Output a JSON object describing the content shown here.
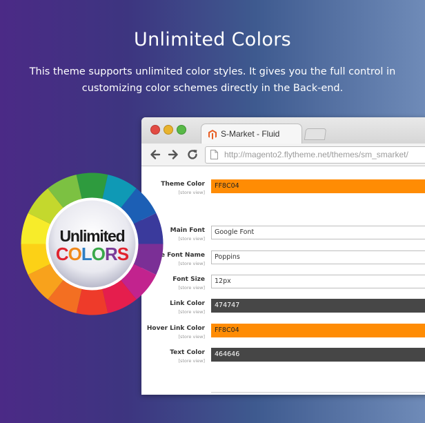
{
  "hero": {
    "title": "Unlimited Colors",
    "subtitle_line1": "This theme supports unlimited color styles. It gives you the full control in",
    "subtitle_line2": "customizing color schemes directly in the Back-end."
  },
  "browser": {
    "tab_title": "S-Market - Fluid",
    "url": "http://magento2.flytheme.net/themes/sm_smarket/",
    "tab_icon": "magento-logo-icon"
  },
  "badge": {
    "line1": "Unlimited",
    "line2_letters": [
      "C",
      "O",
      "L",
      "O",
      "R",
      "S"
    ],
    "line2_colors": [
      "#e0232e",
      "#f08a1c",
      "#2d7ec3",
      "#3aa84a",
      "#7a3b97",
      "#e0232e"
    ]
  },
  "form": {
    "scope_label": "[store view]",
    "rows": [
      {
        "label": "Theme Color",
        "value": "FF8C04",
        "style": "orange"
      },
      {
        "label": "Main Font",
        "value": "Google Font",
        "style": "plain"
      },
      {
        "label": "Google Font Name",
        "value": "Poppins",
        "style": "plain"
      },
      {
        "label": "Font Size",
        "value": "12px",
        "style": "plain"
      },
      {
        "label": "Link Color",
        "value": "474747",
        "style": "dark"
      },
      {
        "label": "Hover Link Color",
        "value": "FF8C04",
        "style": "orange"
      },
      {
        "label": "Text Color",
        "value": "464646",
        "style": "darker"
      }
    ]
  },
  "colors": {
    "accent": "#ff8c04",
    "dark_swatch": "#474747"
  }
}
